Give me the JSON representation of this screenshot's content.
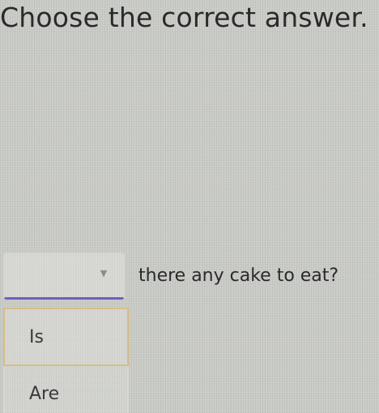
{
  "question": {
    "instruction": "Choose the correct answer.",
    "sentence_rest": "there any cake to eat?"
  },
  "dropdown": {
    "selected_value": "",
    "icon": "chevron-down-icon",
    "options": [
      {
        "label": "Is"
      },
      {
        "label": "Are"
      }
    ]
  },
  "colors": {
    "focus_underline": "#6f5fc0",
    "hover_border": "#d8bf86"
  }
}
